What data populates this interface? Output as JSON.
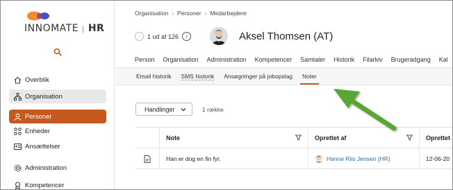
{
  "brand": {
    "name_part1": "INNOMATE",
    "name_sep": "|",
    "name_part2": "HR",
    "colors": {
      "accent": "#c65a1e",
      "logo_orange": "#f28a2e",
      "logo_blue": "#3a56c5",
      "arrow_green": "#5aa634"
    }
  },
  "sidebar": {
    "search_icon": "search-icon",
    "items": [
      {
        "label": "Overblik",
        "icon": "home-icon"
      },
      {
        "label": "Organisation",
        "icon": "org-chart-icon"
      },
      {
        "label": "Personer",
        "icon": "person-icon"
      },
      {
        "label": "Enheder",
        "icon": "units-icon"
      },
      {
        "label": "Ansættelser",
        "icon": "id-card-icon"
      },
      {
        "label": "Administration",
        "icon": "gear-icon"
      },
      {
        "label": "Kompetencer",
        "icon": "competence-icon"
      }
    ]
  },
  "breadcrumb": [
    "Organisation",
    "Personer",
    "Medarbejdere"
  ],
  "pager": {
    "text": "1 ud af 126"
  },
  "person": {
    "name": "Aksel Thomsen (AT)"
  },
  "tabs": [
    "Person",
    "Organisation",
    "Administration",
    "Kompetencer",
    "Samtaler",
    "Historik",
    "Filarkiv",
    "Brugeradgang",
    "Kal"
  ],
  "active_tab": "Historik",
  "subtabs": [
    "Email historik",
    "SMS historik",
    "Ansøgninger på jobopslag",
    "Noter"
  ],
  "active_subtab": "Noter",
  "actions": {
    "label": "Handlinger",
    "row_count": "1 række"
  },
  "table": {
    "headers": {
      "note": "Note",
      "created_by": "Oprettet af",
      "created": "Oprettet"
    },
    "rows": [
      {
        "note": "Han er dog en fin fyr.",
        "created_by": "Hanne Riis Jensen (HR)",
        "created": "12-06-20"
      }
    ]
  }
}
